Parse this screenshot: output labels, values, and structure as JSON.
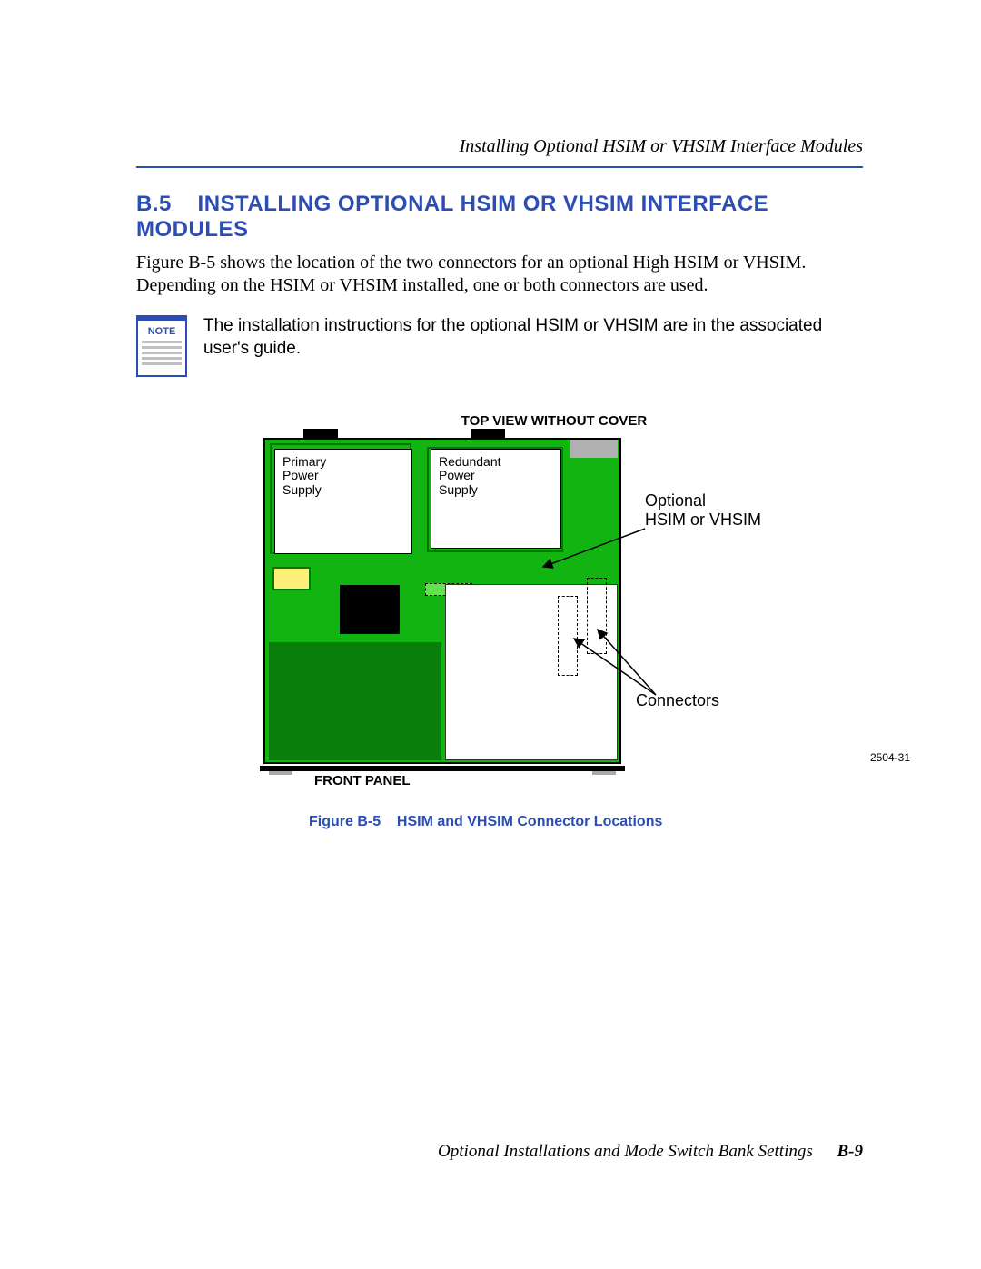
{
  "header": {
    "running_title": "Installing Optional HSIM or VHSIM Interface Modules"
  },
  "section": {
    "number": "B.5",
    "title": "INSTALLING OPTIONAL HSIM OR VHSIM INTERFACE MODULES",
    "body": "Figure B-5 shows the location of the two connectors for an optional High HSIM or VHSIM. Depending on the HSIM or VHSIM installed, one or both connectors are used."
  },
  "note": {
    "label": "NOTE",
    "text": "The installation instructions for the optional HSIM or VHSIM are in the associated user's guide."
  },
  "figure": {
    "top_label": "TOP VIEW WITHOUT COVER",
    "front_label": "FRONT PANEL",
    "primary_ps": "Primary\nPower\nSupply",
    "redundant_ps": "Redundant\nPower\nSupply",
    "callout_optional": "Optional\nHSIM or VHSIM",
    "callout_connectors": "Connectors",
    "ref_number": "2504-31",
    "caption_label": "Figure B-5",
    "caption_text": "HSIM and VHSIM Connector Locations"
  },
  "footer": {
    "text": "Optional Installations and Mode Switch Bank Settings",
    "page": "B-9"
  }
}
